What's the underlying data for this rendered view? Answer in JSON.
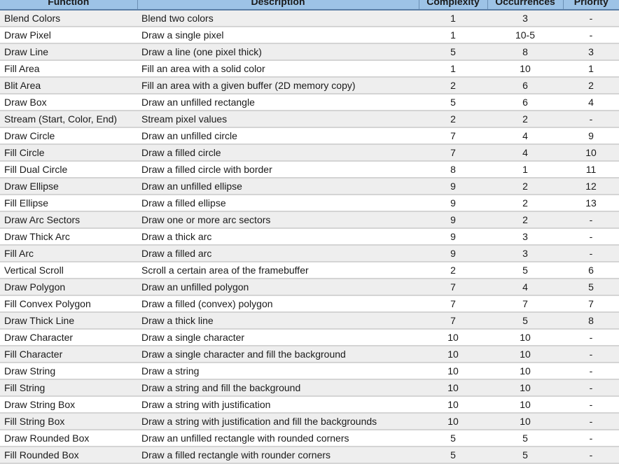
{
  "table": {
    "headers": [
      "Function",
      "Description",
      "Complexity",
      "Occurrences",
      "Priority"
    ],
    "rows": [
      [
        "Blend Colors",
        "Blend two colors",
        "1",
        "3",
        "-"
      ],
      [
        "Draw Pixel",
        "Draw a single pixel",
        "1",
        "10-5",
        "-"
      ],
      [
        "Draw Line",
        "Draw a line (one pixel thick)",
        "5",
        "8",
        "3"
      ],
      [
        "Fill Area",
        "Fill an area with a solid color",
        "1",
        "10",
        "1"
      ],
      [
        "Blit Area",
        "Fill an area with a given buffer (2D memory copy)",
        "2",
        "6",
        "2"
      ],
      [
        "Draw Box",
        "Draw an unfilled rectangle",
        "5",
        "6",
        "4"
      ],
      [
        "Stream (Start, Color, End)",
        "Stream pixel values",
        "2",
        "2",
        "-"
      ],
      [
        "Draw Circle",
        "Draw an unfilled circle",
        "7",
        "4",
        "9"
      ],
      [
        "Fill Circle",
        "Draw a filled circle",
        "7",
        "4",
        "10"
      ],
      [
        "Fill Dual Circle",
        "Draw a filled circle with border",
        "8",
        "1",
        "11"
      ],
      [
        "Draw Ellipse",
        "Draw an unfilled ellipse",
        "9",
        "2",
        "12"
      ],
      [
        "Fill Ellipse",
        "Draw a filled ellipse",
        "9",
        "2",
        "13"
      ],
      [
        "Draw Arc Sectors",
        "Draw one or more arc sectors",
        "9",
        "2",
        "-"
      ],
      [
        "Draw Thick Arc",
        "Draw a thick arc",
        "9",
        "3",
        "-"
      ],
      [
        "Fill Arc",
        "Draw a filled arc",
        "9",
        "3",
        "-"
      ],
      [
        "Vertical Scroll",
        "Scroll a certain area of the framebuffer",
        "2",
        "5",
        "6"
      ],
      [
        "Draw Polygon",
        "Draw an unfilled polygon",
        "7",
        "4",
        "5"
      ],
      [
        "Fill Convex Polygon",
        "Draw a filled (convex) polygon",
        "7",
        "7",
        "7"
      ],
      [
        "Draw Thick Line",
        "Draw a thick line",
        "7",
        "5",
        "8"
      ],
      [
        "Draw Character",
        "Draw a single character",
        "10",
        "10",
        "-"
      ],
      [
        "Fill Character",
        "Draw a single character and fill the background",
        "10",
        "10",
        "-"
      ],
      [
        "Draw String",
        "Draw a string",
        "10",
        "10",
        "-"
      ],
      [
        "Fill String",
        "Draw a string and fill the background",
        "10",
        "10",
        "-"
      ],
      [
        "Draw String Box",
        "Draw a string with justification",
        "10",
        "10",
        "-"
      ],
      [
        "Fill String Box",
        "Draw a string with justification and fill the backgrounds",
        "10",
        "10",
        "-"
      ],
      [
        "Draw Rounded Box",
        "Draw an unfilled rectangle with rounded corners",
        "5",
        "5",
        "-"
      ],
      [
        "Fill Rounded Box",
        "Draw a filled rectangle with rounder corners",
        "5",
        "5",
        "-"
      ]
    ]
  },
  "colors": {
    "header_bg": "#9dc3e6",
    "row_shaded": "#eeeeee",
    "row_plain": "#ffffff"
  }
}
